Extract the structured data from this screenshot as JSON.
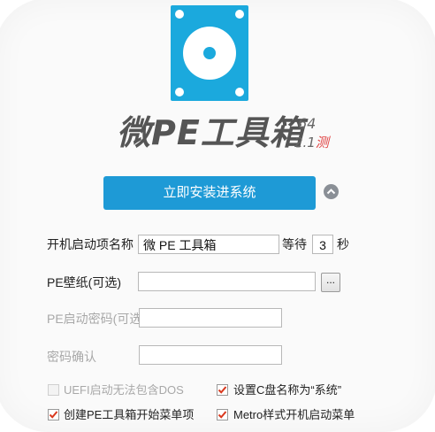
{
  "app": {
    "brand": "微PE工具箱",
    "version_arch": "64",
    "version_num": "2.1",
    "version_tag": "测",
    "accent_color": "#1e9ad6"
  },
  "install_button": {
    "label": "立即安装进系统"
  },
  "collapse_button": {
    "icon": "chevron-up-icon"
  },
  "form": {
    "boot_name": {
      "label": "开机启动项名称",
      "value": "微 PE 工具箱"
    },
    "wait": {
      "label": "等待",
      "value": "3",
      "unit": "秒"
    },
    "wallpaper": {
      "label": "PE壁纸(可选)",
      "value": "",
      "browse_label": "..."
    },
    "password": {
      "label": "PE启动密码(可选)",
      "value": ""
    },
    "password_confirm": {
      "label": "密码确认",
      "value": ""
    }
  },
  "options": {
    "uefi_no_dos": {
      "label": "UEFI启动无法包含DOS",
      "checked": false,
      "disabled": true
    },
    "set_c_name": {
      "label": "设置C盘名称为“系统”",
      "checked": true,
      "disabled": false
    },
    "start_menu": {
      "label": "创建PE工具箱开始菜单项",
      "checked": true,
      "disabled": false
    },
    "metro_menu": {
      "label": "Metro样式开机启动菜单",
      "checked": true,
      "disabled": false
    }
  }
}
